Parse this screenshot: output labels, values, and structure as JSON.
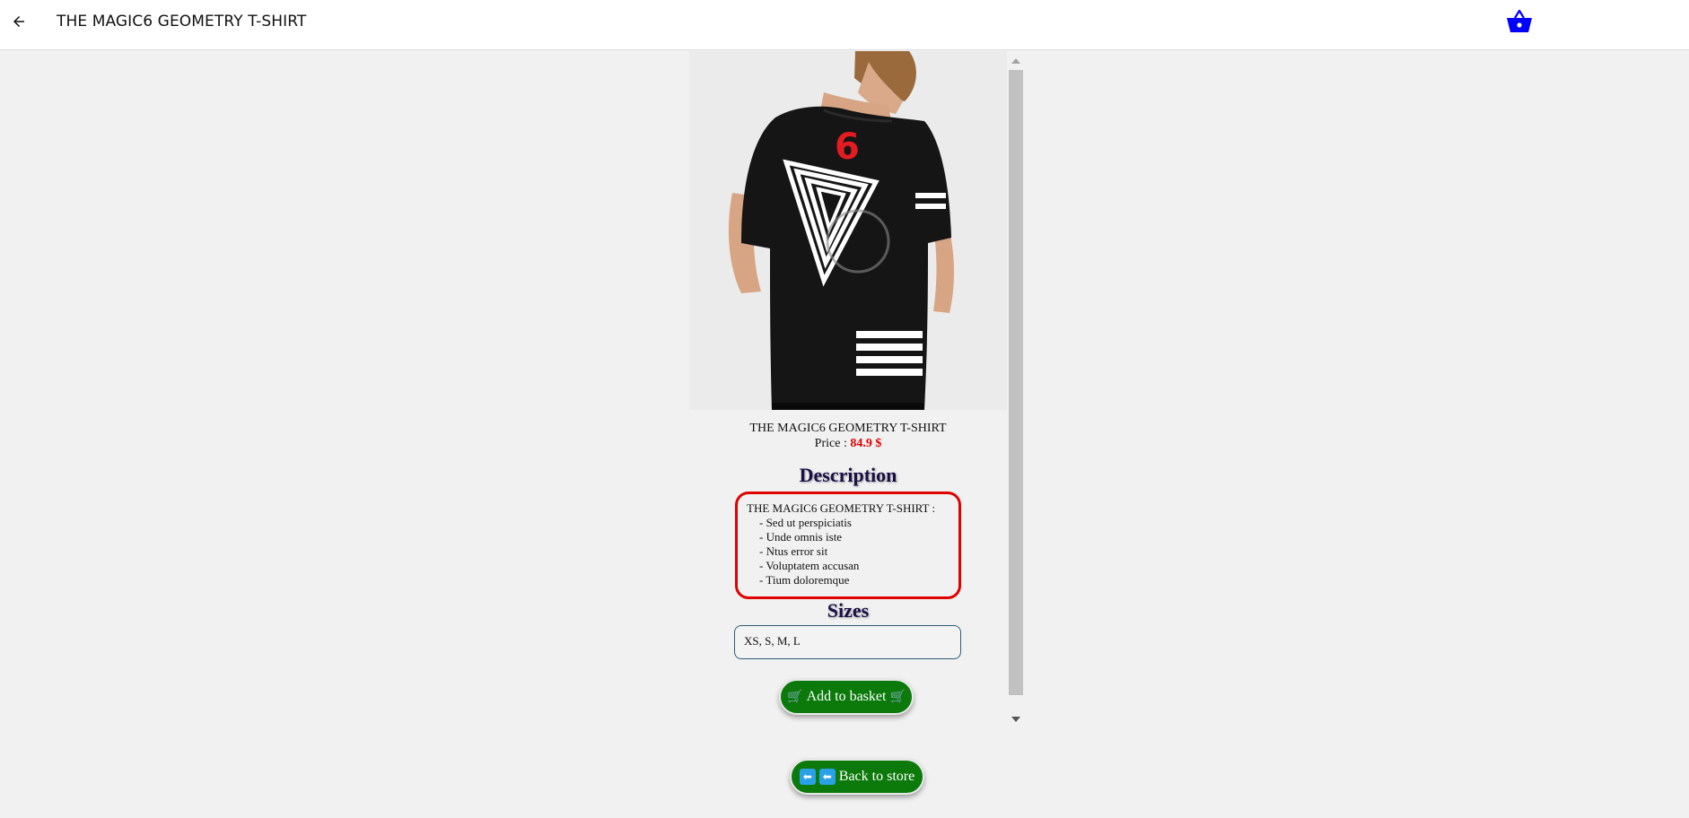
{
  "header": {
    "title": "THE MAGIC6 GEOMETRY T-SHIRT",
    "back_icon": "arrow-left-icon",
    "basket_icon": "basket-icon",
    "basket_color": "#0000ff"
  },
  "product": {
    "name": "THE MAGIC6 GEOMETRY T-SHIRT",
    "price_label": "Price : ",
    "price_value": "84.9 $",
    "price_color": "#e00000",
    "image_alt": "Back view of model wearing black t-shirt with red 6 and white triangle geometry print"
  },
  "description": {
    "heading": "Description",
    "intro": "THE MAGIC6 GEOMETRY T-SHIRT :",
    "items": [
      "- Sed ut perspiciatis",
      "- Unde omnis iste",
      "- Ntus error sit",
      "- Voluptatem accusan",
      "- Tium doloremque"
    ]
  },
  "sizes": {
    "heading": "Sizes",
    "value": "XS, S, M, L"
  },
  "actions": {
    "add_to_basket": "Add to basket",
    "back_to_store": "Back to store",
    "button_color": "#0b7a0b"
  }
}
